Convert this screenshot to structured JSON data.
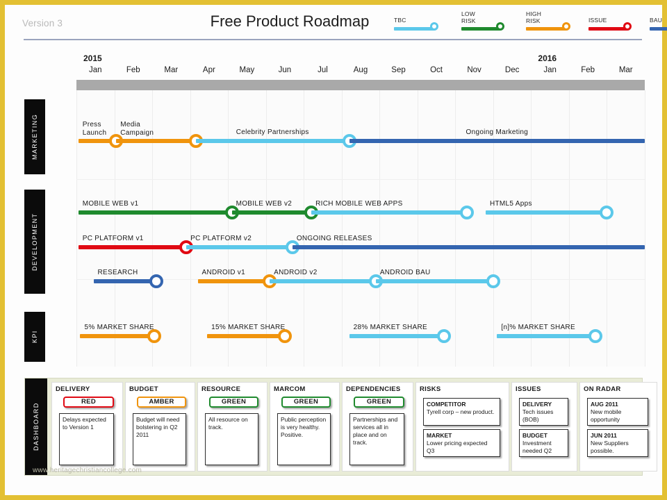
{
  "header": {
    "version": "Version 3",
    "title": "Free Product Roadmap",
    "watermark": "www.heritagechristiancollege.com"
  },
  "colors": {
    "tbc": "#5bc8ea",
    "low_risk": "#1f8a2e",
    "high_risk": "#f0940d",
    "issue": "#e00913",
    "bau": "#3465b0",
    "border": "#e3c033",
    "grayband": "#a9a9a9",
    "dashboard_bg": "#e9ecd7",
    "tab_bg": "#0b0b0b",
    "red": "#e00913",
    "amber": "#f0940d",
    "green": "#1f8a2e"
  },
  "legend": [
    {
      "label": "TBC",
      "color_key": "tbc",
      "color": "#5bc8ea"
    },
    {
      "label": "LOW\nRISK",
      "color_key": "low_risk",
      "color": "#1f8a2e"
    },
    {
      "label": "HIGH\nRISK",
      "color_key": "high_risk",
      "color": "#f0940d"
    },
    {
      "label": "ISSUE",
      "color_key": "issue",
      "color": "#e00913"
    },
    {
      "label": "BAU",
      "color_key": "bau",
      "color": "#3465b0"
    }
  ],
  "timeline": {
    "years": [
      {
        "label": "2015",
        "month_index": 0
      },
      {
        "label": "2016",
        "month_index": 12
      }
    ],
    "months": [
      "Jan",
      "Feb",
      "Mar",
      "Apr",
      "May",
      "Jun",
      "Jul",
      "Aug",
      "Sep",
      "Oct",
      "Nov",
      "Dec",
      "Jan",
      "Feb",
      "Mar"
    ]
  },
  "swimlanes": [
    {
      "name": "MARKETING",
      "label": "MARKETING"
    },
    {
      "name": "DEVELOPMENT",
      "label": "DEVELOPMENT"
    },
    {
      "name": "KPI",
      "label": "KPI"
    }
  ],
  "chart_data": {
    "type": "timeline",
    "title": "Free Product Roadmap",
    "x_axis": {
      "unit": "month",
      "categories": [
        "Jan 2015",
        "Feb 2015",
        "Mar 2015",
        "Apr 2015",
        "May 2015",
        "Jun 2015",
        "Jul 2015",
        "Aug 2015",
        "Sep 2015",
        "Oct 2015",
        "Nov 2015",
        "Dec 2015",
        "Jan 2016",
        "Feb 2016",
        "Mar 2016"
      ],
      "range": [
        0,
        15
      ]
    },
    "legend_position": "top-right",
    "grid": true,
    "lanes": [
      {
        "lane": "MARKETING",
        "rows": [
          {
            "row": 0,
            "bars": [
              {
                "label": "Press\nLaunch",
                "status": "HIGH RISK",
                "color": "#f0940d",
                "start_month": 0.05,
                "end_month": 1.05,
                "marker": "end",
                "label_lines": 2
              },
              {
                "label": "Media\nCampaign",
                "status": "HIGH RISK",
                "color": "#f0940d",
                "start_month": 1.05,
                "end_month": 3.15,
                "marker": "end",
                "label_lines": 2
              },
              {
                "label": "Celebrity Partnerships",
                "status": "TBC",
                "color": "#5bc8ea",
                "start_month": 3.15,
                "end_month": 7.2,
                "marker": "end",
                "label_lines": 1
              },
              {
                "label": "Ongoing Marketing",
                "status": "BAU",
                "color": "#3465b0",
                "start_month": 7.2,
                "end_month": 15.0,
                "marker": "none",
                "label_lines": 1
              }
            ]
          }
        ]
      },
      {
        "lane": "DEVELOPMENT",
        "rows": [
          {
            "row": 0,
            "bars": [
              {
                "label": "MOBILE  WEB  v1",
                "status": "LOW RISK",
                "color": "#1f8a2e",
                "start_month": 0.05,
                "end_month": 4.1,
                "marker": "end",
                "label_lines": 1
              },
              {
                "label": "MOBILE  WEB  v2",
                "status": "LOW RISK",
                "color": "#1f8a2e",
                "start_month": 4.1,
                "end_month": 6.2,
                "marker": "end",
                "label_lines": 1
              },
              {
                "label": "RICH  MOBILE  WEB  APPS",
                "status": "TBC",
                "color": "#5bc8ea",
                "start_month": 6.2,
                "end_month": 10.3,
                "marker": "end",
                "label_lines": 1
              },
              {
                "label": "HTML5 Apps",
                "status": "TBC",
                "color": "#5bc8ea",
                "start_month": 10.8,
                "end_month": 14.0,
                "marker": "end",
                "label_lines": 1
              }
            ]
          },
          {
            "row": 1,
            "bars": [
              {
                "label": "PC PLATFORM  v1",
                "status": "ISSUE",
                "color": "#e00913",
                "start_month": 0.05,
                "end_month": 2.9,
                "marker": "end",
                "label_lines": 1
              },
              {
                "label": "PC PLATFORM  v2",
                "status": "TBC",
                "color": "#5bc8ea",
                "start_month": 2.9,
                "end_month": 5.7,
                "marker": "end",
                "label_lines": 1
              },
              {
                "label": "ONGOING  RELEASES",
                "status": "BAU",
                "color": "#3465b0",
                "start_month": 5.7,
                "end_month": 15.0,
                "marker": "none",
                "label_lines": 1
              }
            ]
          },
          {
            "row": 2,
            "bars": [
              {
                "label": "RESEARCH",
                "status": "BAU",
                "color": "#3465b0",
                "start_month": 0.45,
                "end_month": 2.1,
                "marker": "end",
                "label_lines": 1
              },
              {
                "label": "ANDROID  v1",
                "status": "HIGH RISK",
                "color": "#f0940d",
                "start_month": 3.2,
                "end_month": 5.1,
                "marker": "end",
                "label_lines": 1
              },
              {
                "label": "ANDROID  v2",
                "status": "TBC",
                "color": "#5bc8ea",
                "start_month": 5.1,
                "end_month": 7.9,
                "marker": "end",
                "label_lines": 1
              },
              {
                "label": "ANDROID  BAU",
                "status": "TBC",
                "color": "#5bc8ea",
                "start_month": 7.9,
                "end_month": 11.0,
                "marker": "end",
                "label_lines": 1
              }
            ]
          }
        ]
      },
      {
        "lane": "KPI",
        "rows": [
          {
            "row": 0,
            "bars": [
              {
                "label": "5% MARKET  SHARE",
                "status": "HIGH RISK",
                "color": "#f0940d",
                "start_month": 0.1,
                "end_month": 2.05,
                "marker": "end",
                "label_lines": 1
              },
              {
                "label": "15% MARKET  SHARE",
                "status": "HIGH RISK",
                "color": "#f0940d",
                "start_month": 3.45,
                "end_month": 5.5,
                "marker": "end",
                "label_lines": 1
              },
              {
                "label": "28% MARKET  SHARE",
                "status": "TBC",
                "color": "#5bc8ea",
                "start_month": 7.2,
                "end_month": 9.7,
                "marker": "end",
                "label_lines": 1
              },
              {
                "label": "[n]% MARKET  SHARE",
                "status": "TBC",
                "color": "#5bc8ea",
                "start_month": 11.1,
                "end_month": 13.7,
                "marker": "end",
                "label_lines": 1
              }
            ]
          }
        ]
      }
    ]
  },
  "dashboard": {
    "tab_label": "DASHBOARD",
    "columns": [
      {
        "title": "DELIVERY",
        "rag": {
          "label": "RED",
          "color": "#e00913"
        },
        "notes": [
          {
            "heading": "",
            "text": "Delays expected to Version 1"
          }
        ]
      },
      {
        "title": "BUDGET",
        "rag": {
          "label": "AMBER",
          "color": "#f0940d"
        },
        "notes": [
          {
            "heading": "",
            "text": "Budget will need bolstering in Q2 2011"
          }
        ]
      },
      {
        "title": "RESOURCE",
        "rag": {
          "label": "GREEN",
          "color": "#1f8a2e"
        },
        "notes": [
          {
            "heading": "",
            "text": "All resource on track."
          }
        ]
      },
      {
        "title": "MARCOM",
        "rag": {
          "label": "GREEN",
          "color": "#1f8a2e"
        },
        "notes": [
          {
            "heading": "",
            "text": "Public perception is very healthy. Positive."
          }
        ]
      },
      {
        "title": "DEPENDENCIES",
        "rag": {
          "label": "GREEN",
          "color": "#1f8a2e"
        },
        "notes": [
          {
            "heading": "",
            "text": "Partnerships and services all in place and on track."
          }
        ]
      },
      {
        "title": "RISKS",
        "rag": null,
        "notes": [
          {
            "heading": "COMPETITOR",
            "text": "Tyrell corp – new product."
          },
          {
            "heading": "MARKET",
            "text": "Lower pricing expected Q3"
          }
        ]
      },
      {
        "title": "ISSUES",
        "rag": null,
        "notes": [
          {
            "heading": "DELIVERY",
            "text": "Tech issues (BOB)"
          },
          {
            "heading": "BUDGET",
            "text": "Investment needed  Q2"
          }
        ]
      },
      {
        "title": "ON RADAR",
        "rag": null,
        "notes": [
          {
            "heading": "AUG 2011",
            "text": "New mobile opportunity"
          },
          {
            "heading": "JUN 2011",
            "text": "New Suppliers possible."
          }
        ]
      }
    ]
  }
}
